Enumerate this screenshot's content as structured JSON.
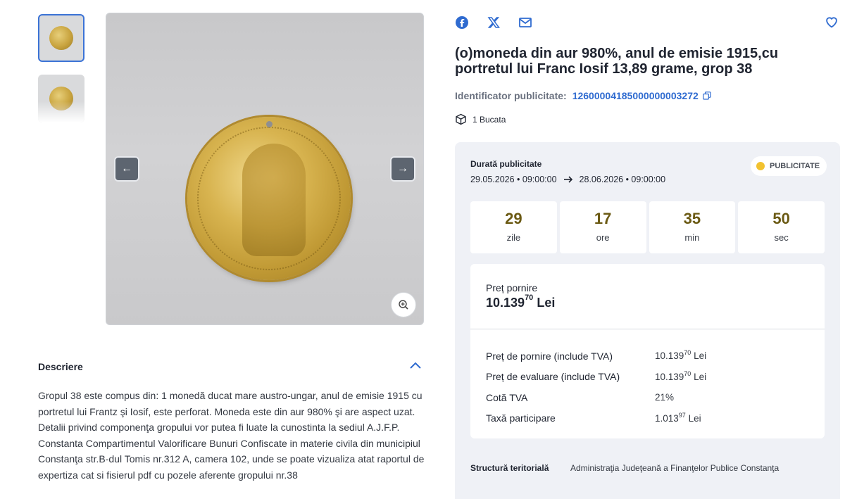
{
  "gallery": {
    "prev_label": "←",
    "next_label": "→"
  },
  "description": {
    "title": "Descriere",
    "text": "Gropul 38 este compus din: 1 monedă ducat mare austro-ungar, anul de emisie 1915 cu portretul lui Frantz şi Iosif, este perforat. Moneda este din aur 980% şi are aspect uzat. Detalii privind componenţa gropului vor putea fi luate la cunostinta la sediul A.J.F.P. Constanta Compartimentul Valorificare Bunuri Confiscate in materie civila din municipiul Constanţa str.B-dul Tomis nr.312 A, camera 102, unde se poate vizualiza atat raportul de expertiza cat si fisierul pdf cu pozele aferente gropului nr.38"
  },
  "lot": {
    "title": "(o)moneda din aur 980%, anul de emisie 1915,cu portretul lui Franc Iosif 13,89 grame, grop 38",
    "identifier_label": "Identificator publicitate:",
    "identifier_value": "12600004185000000003272",
    "quantity": "1 Bucata"
  },
  "publication": {
    "duration_label": "Durată publicitate",
    "start": "29.05.2026 • 09:00:00",
    "end": "28.06.2026 • 09:00:00",
    "status": "PUBLICITATE",
    "status_color": "#f2c230"
  },
  "countdown": [
    {
      "value": "29",
      "unit": "zile"
    },
    {
      "value": "17",
      "unit": "ore"
    },
    {
      "value": "35",
      "unit": "min"
    },
    {
      "value": "50",
      "unit": "sec"
    }
  ],
  "pricing": {
    "start_label": "Preț pornire",
    "start_value_main": "10.139",
    "start_value_sup": "70",
    "start_value_currency": "Lei",
    "rows": [
      {
        "label": "Preț de pornire (include TVA)",
        "main": "10.139",
        "sup": "70",
        "currency": "Lei"
      },
      {
        "label": "Preț de evaluare (include TVA)",
        "main": "10.139",
        "sup": "70",
        "currency": "Lei"
      },
      {
        "label": "Cotă TVA",
        "main": "21%",
        "sup": "",
        "currency": ""
      },
      {
        "label": "Taxă participare",
        "main": "1.013",
        "sup": "97",
        "currency": "Lei"
      }
    ]
  },
  "territory": {
    "label": "Structură teritorială",
    "value": "Administraţia Judeţeană a Finanţelor Publice Constanţa"
  },
  "colors": {
    "accent": "#2f6bd0",
    "panel_bg": "#eff1f6",
    "countdown_number": "#6b5a14"
  },
  "icons": {
    "share": [
      "facebook-icon",
      "x-icon",
      "mail-icon"
    ],
    "favorite": "heart-icon",
    "copy": "copy-icon",
    "quantity": "box-icon",
    "zoom": "zoom-in-icon",
    "collapse": "chevron-up-icon"
  }
}
